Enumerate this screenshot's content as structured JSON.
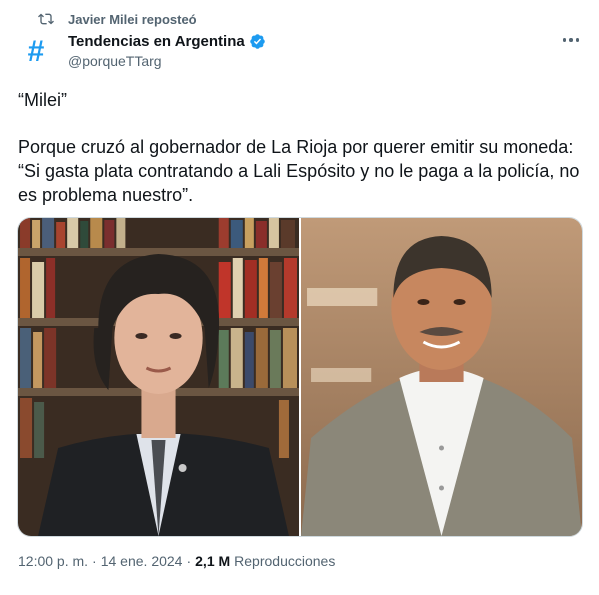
{
  "repost": {
    "label": "Javier Milei reposteó"
  },
  "author": {
    "display_name": "Tendencias en Argentina",
    "handle": "@porqueTTarg",
    "avatar_glyph": "#"
  },
  "tweet": {
    "paragraph1": "“Milei”",
    "paragraph2": "Porque cruzó al gobernador de La Rioja por querer emitir su moneda: “Si gasta plata contratando a Lali Espósito y no le paga a la policía, no es problema nuestro”."
  },
  "meta": {
    "time": "12:00 p. m.",
    "sep1": "·",
    "date": "14 ene. 2024",
    "sep2": "·",
    "views_count": "2,1 M",
    "views_label": "Reproducciones"
  },
  "icons": {
    "repost": "repost-icon",
    "verified": "verified-badge-icon",
    "more": "more-options-icon",
    "avatar": "hashtag-avatar-icon"
  },
  "colors": {
    "accent": "#1d9bf0",
    "secondary_text": "#536471",
    "primary_text": "#0f1419"
  }
}
